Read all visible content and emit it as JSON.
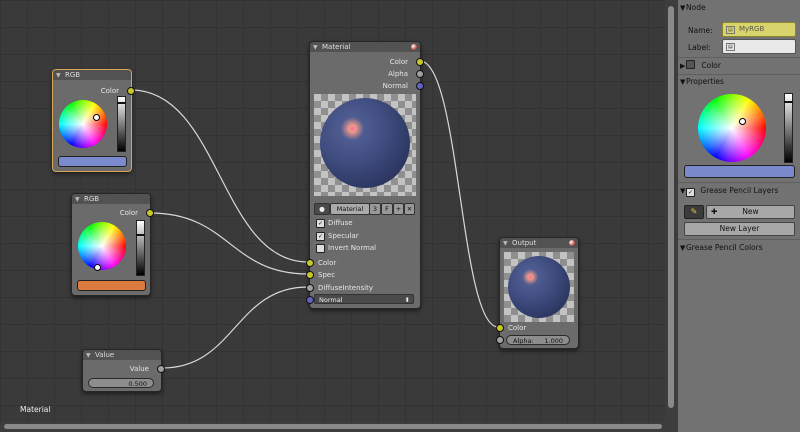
{
  "nodes": {
    "rgb1": {
      "title": "RGB",
      "output": "Color",
      "swatch_color": "#7a8acc"
    },
    "rgb2": {
      "title": "RGB",
      "output": "Color",
      "swatch_color": "#dd7a40"
    },
    "value": {
      "title": "Value",
      "output": "Value",
      "field_value": "0.500"
    },
    "material": {
      "title": "Material",
      "outputs": [
        "Color",
        "Alpha",
        "Normal"
      ],
      "datablock": "Material",
      "user_count": "3",
      "fake_user": "F",
      "options": [
        "Diffuse",
        "Specular",
        "Invert Normal"
      ],
      "inputs": [
        "Color",
        "Spec",
        "DiffuseIntensity"
      ],
      "normal_select": "Normal"
    },
    "output": {
      "title": "Output",
      "input": "Color",
      "alpha_label": "Alpha:",
      "alpha_value": "1.000"
    }
  },
  "editor": {
    "footer_label": "Material"
  },
  "panel": {
    "node_section": "Node",
    "name_label": "Name:",
    "name_value": "MyRGB",
    "label_label": "Label:",
    "label_value": "",
    "color_section": "Color",
    "properties_section": "Properties",
    "prop_swatch_color": "#7a8acc",
    "grease_layers": "Grease Pencil Layers",
    "new_button": "New",
    "new_layer_button": "New Layer",
    "grease_colors": "Grease Pencil Colors"
  },
  "colors": {
    "selected_outline": "#d7a55a",
    "socket_color": "#c7c729",
    "socket_value": "#a1a1a1",
    "socket_vector": "#6363c7"
  }
}
